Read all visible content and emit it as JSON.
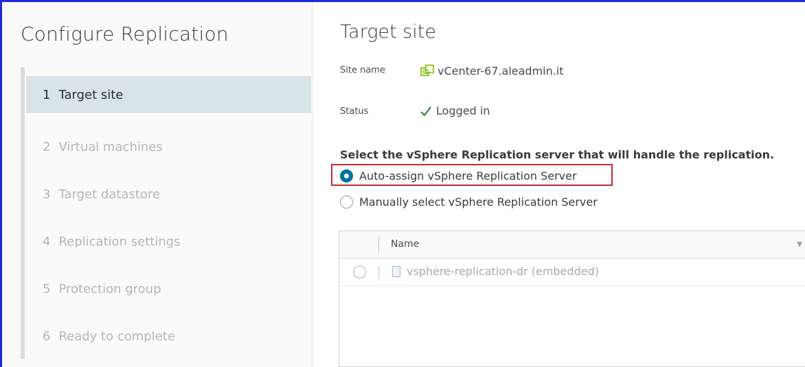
{
  "wizard": {
    "title": "Configure Replication",
    "steps": [
      {
        "num": "1",
        "label": "Target site"
      },
      {
        "num": "2",
        "label": "Virtual machines"
      },
      {
        "num": "3",
        "label": "Target datastore"
      },
      {
        "num": "4",
        "label": "Replication settings"
      },
      {
        "num": "5",
        "label": "Protection group"
      },
      {
        "num": "6",
        "label": "Ready to complete"
      }
    ]
  },
  "page": {
    "title": "Target site",
    "site_name_label": "Site name",
    "site_name_value": "vCenter-67.aleadmin.it",
    "status_label": "Status",
    "status_value": "Logged in",
    "question": "Select the vSphere Replication server that will handle the replication.",
    "options": [
      {
        "label": "Auto-assign vSphere Replication Server",
        "checked": true
      },
      {
        "label": "Manually select vSphere Replication Server",
        "checked": false
      }
    ]
  },
  "grid": {
    "column_name": "Name",
    "rows": [
      {
        "name": "vsphere-replication-dr (embedded)"
      }
    ]
  },
  "colors": {
    "accent": "#0072a3",
    "highlight": "#c8262b",
    "success": "#2e8540",
    "vcenter_icon": "#7ab800"
  },
  "icons": {
    "site": "vcenter-icon",
    "status": "check-icon",
    "row": "vm-icon"
  }
}
